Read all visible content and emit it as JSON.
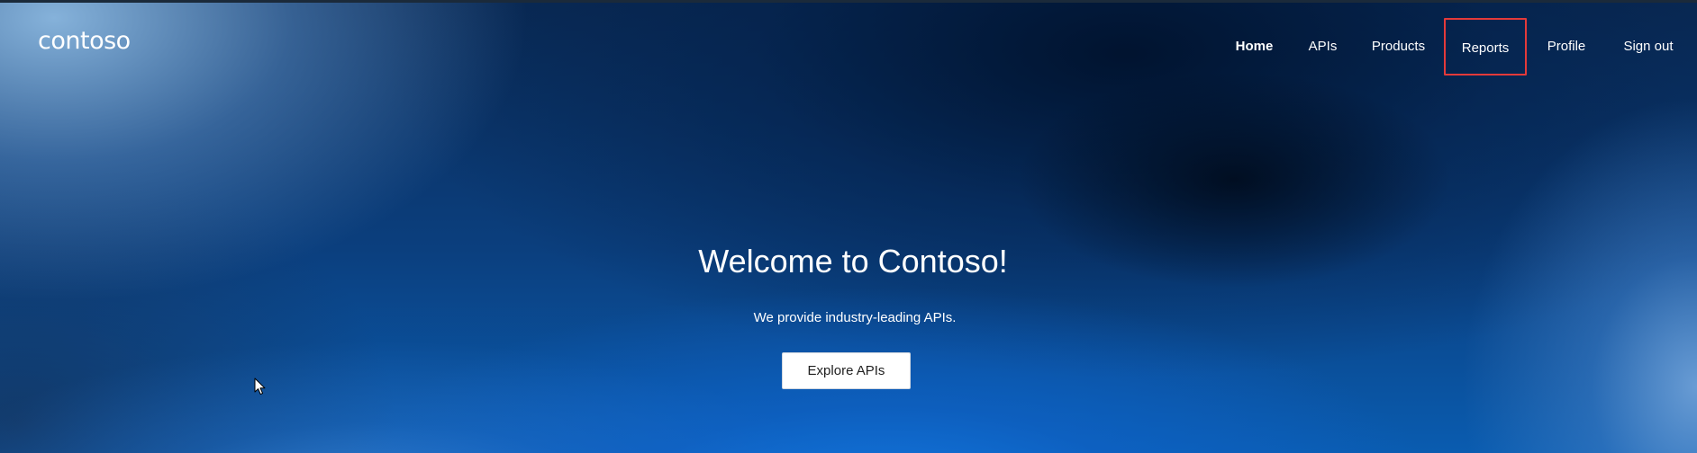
{
  "brand": {
    "logo_text": "contoso"
  },
  "nav": {
    "items": [
      {
        "label": "Home",
        "active": true,
        "highlighted": false
      },
      {
        "label": "APIs",
        "active": false,
        "highlighted": false
      },
      {
        "label": "Products",
        "active": false,
        "highlighted": false
      },
      {
        "label": "Reports",
        "active": false,
        "highlighted": true
      },
      {
        "label": "Profile",
        "active": false,
        "highlighted": false
      },
      {
        "label": "Sign out",
        "active": false,
        "highlighted": false
      }
    ]
  },
  "hero": {
    "title": "Welcome to Contoso!",
    "subtitle": "We provide industry-leading APIs.",
    "cta_label": "Explore APIs"
  },
  "colors": {
    "highlight_border": "#e43a3a",
    "text": "#ffffff",
    "button_bg": "#ffffff"
  },
  "icons": {
    "cursor": "mouse-pointer-icon"
  }
}
